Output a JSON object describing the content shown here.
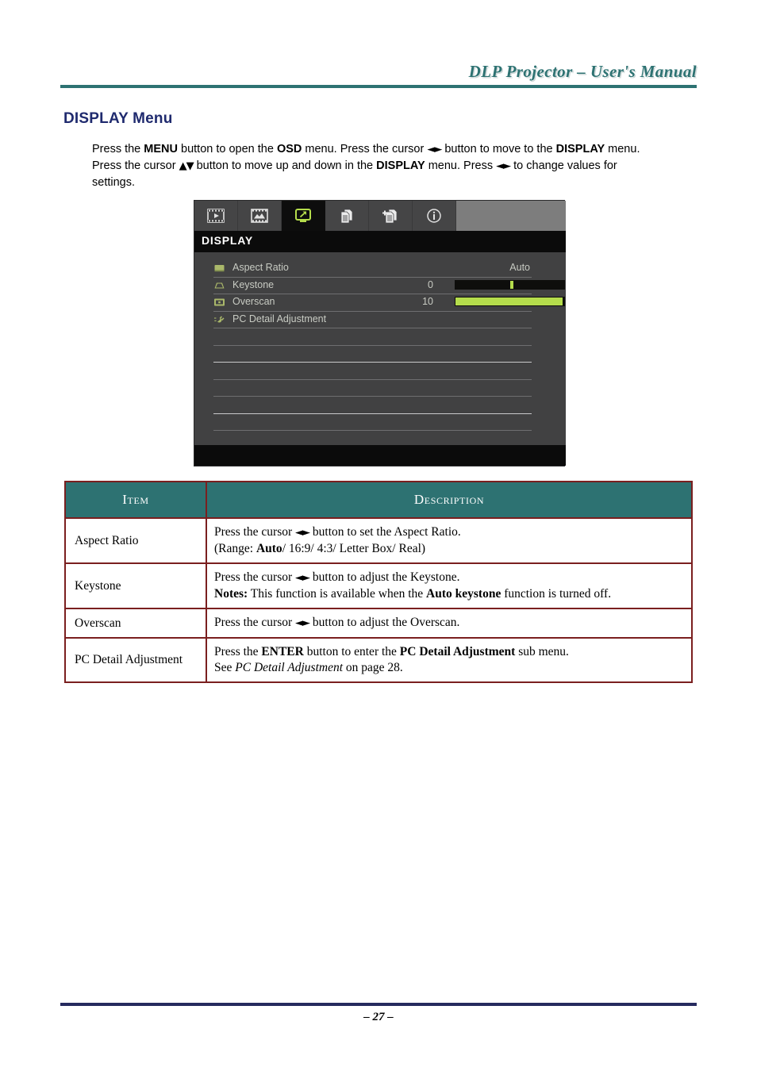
{
  "header": {
    "title": "DLP Projector – User's Manual"
  },
  "section": {
    "title": "DISPLAY Menu",
    "intro_line1_a": "Press the ",
    "intro_menu": "MENU",
    "intro_line1_b": " button to open the ",
    "intro_osd": "OSD",
    "intro_line1_c": " menu. Press the cursor ",
    "intro_arrows_lr_1": "◄►",
    "intro_line1_d": " button to move to the ",
    "intro_display_1": "DISPLAY",
    "intro_line2_a": " menu. Press the cursor ",
    "intro_arrows_ud": "▲▼",
    "intro_line2_b": " button to move up and down in the ",
    "intro_display_2": "DISPLAY",
    "intro_line2_c": " menu. Press ",
    "intro_arrows_lr_2": "◄►",
    "intro_line3": " to change values for settings."
  },
  "osd": {
    "title": "DISPLAY",
    "tabs": [
      {
        "name": "image-tab",
        "icon": "filmstrip-play-icon",
        "active": false
      },
      {
        "name": "computer-tab",
        "icon": "filmstrip-picture-icon",
        "active": false
      },
      {
        "name": "display-tab",
        "icon": "monitor-arrow-icon",
        "active": true
      },
      {
        "name": "system-setup-basic-tab",
        "icon": "documents-icon",
        "active": false
      },
      {
        "name": "system-setup-advanced-tab",
        "icon": "documents-plus-icon",
        "active": false
      },
      {
        "name": "status-tab",
        "icon": "info-circle-icon",
        "active": false
      }
    ],
    "rows": [
      {
        "label": "Aspect Ratio",
        "icon": "aspect-ratio-icon",
        "value": "Auto",
        "control": "text"
      },
      {
        "label": "Keystone",
        "icon": "keystone-icon",
        "value": "0",
        "control": "slider",
        "fill_percent": 0,
        "handle_percent": 50
      },
      {
        "label": "Overscan",
        "icon": "overscan-icon",
        "value": "10",
        "control": "slider",
        "fill_percent": 98,
        "handle_percent": 98
      },
      {
        "label": "PC Detail Adjustment",
        "icon": "plug-icon",
        "value": "",
        "control": "none"
      }
    ],
    "blank_row_count": 7,
    "colors": {
      "accent_green": "#b5dd4c",
      "panel_bg": "#414142",
      "tab_bg": "#454546",
      "tab_active_bg": "#0d0d0d",
      "tab_strip_bg": "#7d7d7d",
      "text": "#c8cbc3"
    }
  },
  "table": {
    "headers": [
      "Item",
      "Description"
    ],
    "rows": [
      {
        "item": "Aspect Ratio",
        "lines": [
          [
            {
              "t": "Press the cursor ",
              "s": "n"
            },
            {
              "t": "◄►",
              "s": "a"
            },
            {
              "t": " button to set the Aspect Ratio.",
              "s": "n"
            }
          ],
          [
            {
              "t": "(Range: ",
              "s": "n"
            },
            {
              "t": "Auto",
              "s": "b"
            },
            {
              "t": "/ 16:9/ 4:3/ Letter Box/ Real)",
              "s": "n"
            }
          ]
        ]
      },
      {
        "item": "Keystone",
        "lines": [
          [
            {
              "t": "Press the cursor ",
              "s": "n"
            },
            {
              "t": "◄►",
              "s": "a"
            },
            {
              "t": " button to adjust the Keystone.",
              "s": "n"
            }
          ],
          [
            {
              "t": "Notes:",
              "s": "b"
            },
            {
              "t": " This function is available when the ",
              "s": "n"
            },
            {
              "t": "Auto keystone",
              "s": "b"
            },
            {
              "t": " function is turned off.",
              "s": "n"
            }
          ]
        ]
      },
      {
        "item": "Overscan",
        "lines": [
          [
            {
              "t": "Press the cursor ",
              "s": "n"
            },
            {
              "t": "◄►",
              "s": "a"
            },
            {
              "t": " button to adjust the Overscan.",
              "s": "n"
            }
          ]
        ]
      },
      {
        "item": "PC Detail Adjustment",
        "lines": [
          [
            {
              "t": "Press the ",
              "s": "n"
            },
            {
              "t": "ENTER",
              "s": "b"
            },
            {
              "t": " button to enter the ",
              "s": "n"
            },
            {
              "t": "PC Detail Adjustment",
              "s": "b"
            },
            {
              "t": " sub menu.",
              "s": "n"
            }
          ],
          [
            {
              "t": "See ",
              "s": "n"
            },
            {
              "t": "PC Detail Adjustment",
              "s": "i"
            },
            {
              "t": " on page 28.",
              "s": "n"
            }
          ]
        ]
      }
    ]
  },
  "footer": {
    "page_number": "– 27 –"
  }
}
